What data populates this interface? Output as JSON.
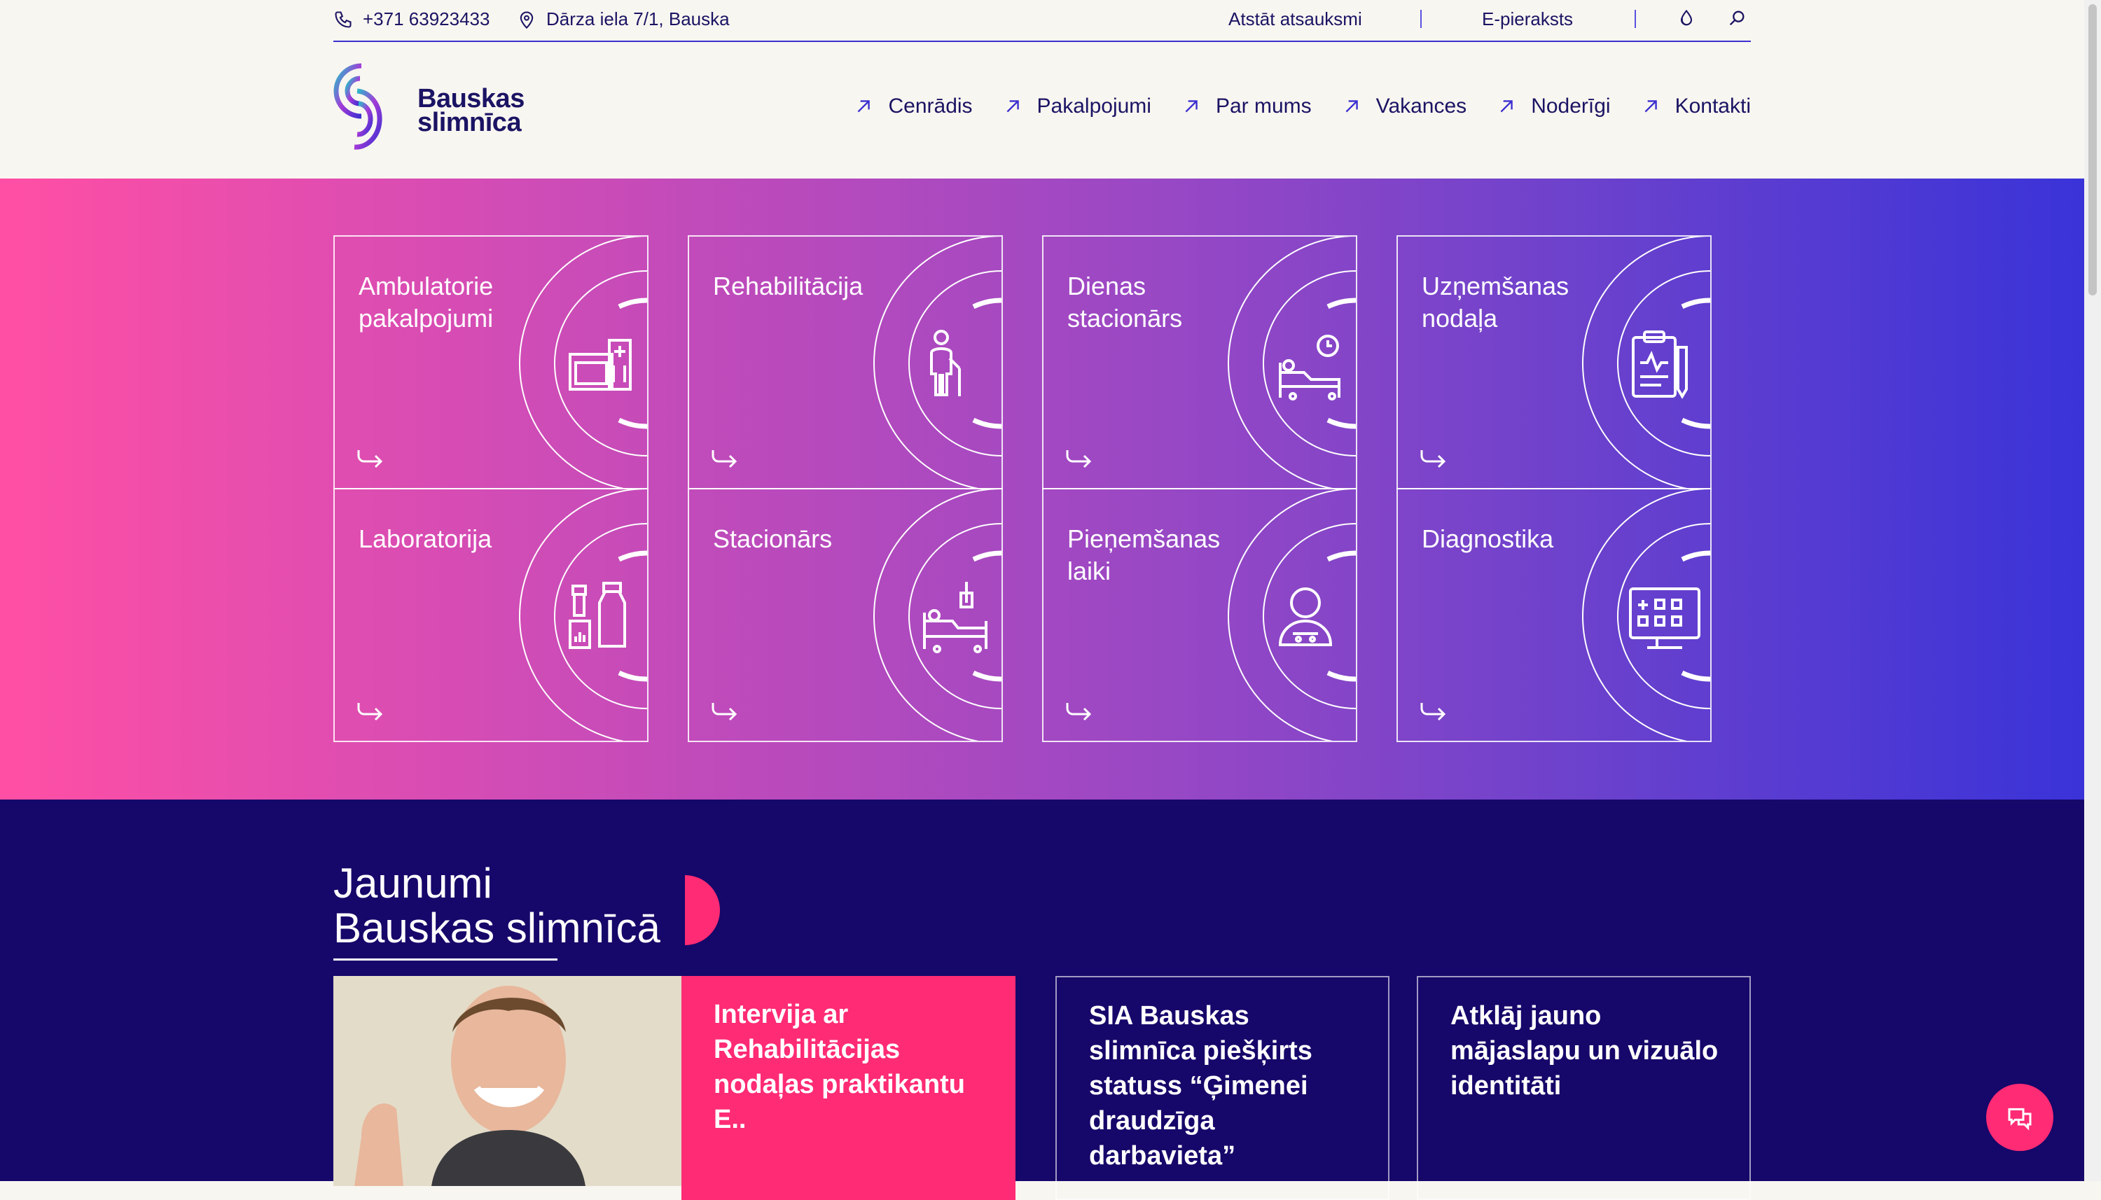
{
  "topbar": {
    "phone": "+371 63923433",
    "address": "Dārza iela 7/1, Bauska",
    "feedback": "Atstāt atsauksmi",
    "e_booking": "E-pieraksts"
  },
  "logo": {
    "line1": "Bauskas",
    "line2": "slimnīca"
  },
  "nav": {
    "items": [
      {
        "label": "Cenrādis"
      },
      {
        "label": "Pakalpojumi"
      },
      {
        "label": "Par mums"
      },
      {
        "label": "Vakances"
      },
      {
        "label": "Noderīgi"
      },
      {
        "label": "Kontakti"
      }
    ]
  },
  "services": [
    {
      "label": "Ambulatorie pakalpojumi",
      "icon": "building-icon"
    },
    {
      "label": "Rehabilitācija",
      "icon": "walking-person-icon"
    },
    {
      "label": "Dienas stacionārs",
      "icon": "bed-clock-icon"
    },
    {
      "label": "Uzņemšanas nodaļa",
      "icon": "clipboard-icon"
    },
    {
      "label": "Laboratorija",
      "icon": "lab-bottles-icon"
    },
    {
      "label": "Stacionārs",
      "icon": "hospital-bed-icon"
    },
    {
      "label": "Pieņemšanas laiki",
      "icon": "patient-icon"
    },
    {
      "label": "Diagnostika",
      "icon": "monitor-icon"
    }
  ],
  "news": {
    "title_line1": "Jaunumi",
    "title_line2": "Bauskas slimnīcā",
    "items": [
      {
        "title": "Intervija ar Rehabilitācijas nodaļas praktikantu E.."
      },
      {
        "title": "SIA Bauskas slimnīca piešķirts statuss “Ģimenei draudzīga darbavieta”"
      },
      {
        "title": "Atklāj jauno mājaslapu un vizuālo identitāti"
      }
    ]
  },
  "colors": {
    "navy": "#16076a",
    "pink": "#ff2b74",
    "accent": "#3b2fd0"
  }
}
